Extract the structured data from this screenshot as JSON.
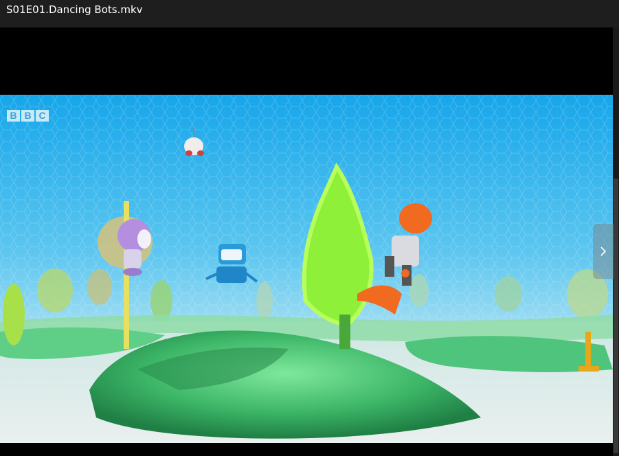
{
  "window": {
    "title": "S01E01.Dancing Bots.mkv"
  },
  "video": {
    "watermark": {
      "letters": [
        "B",
        "B",
        "C"
      ]
    }
  },
  "controls": {
    "next_icon": "chevron-right-icon"
  },
  "colors": {
    "titlebar": "#1e1e1e",
    "sky": "#2fb2ec",
    "grass": "#3fbf6a"
  }
}
